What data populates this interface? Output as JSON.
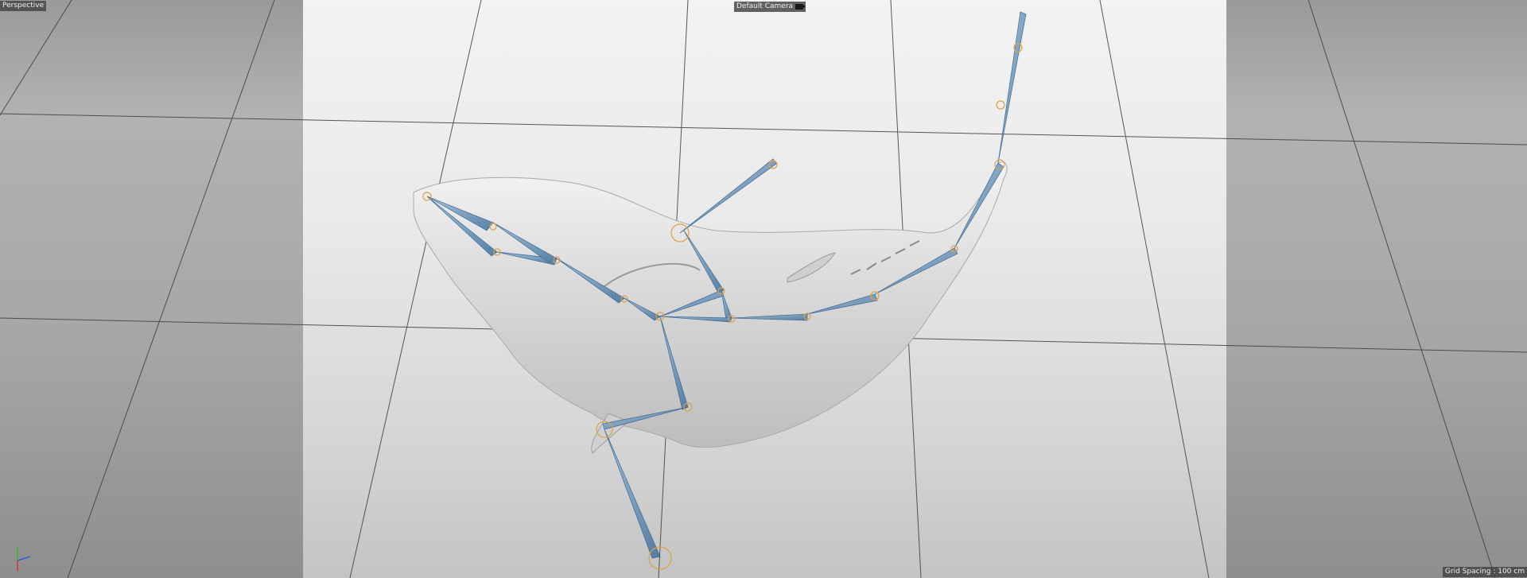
{
  "viewport": {
    "view_name": "Perspective",
    "camera_name": "Default Camera",
    "grid_spacing": "Grid Spacing : 100 cm"
  },
  "icons": {
    "camera": "camera-icon",
    "axis": "axis-gizmo-icon"
  },
  "colors": {
    "bone_blue": "#4a7fb0",
    "joint_orange": "#e0a040",
    "axis_x": "#e03030",
    "axis_y": "#30c030",
    "axis_z": "#3060e0"
  }
}
